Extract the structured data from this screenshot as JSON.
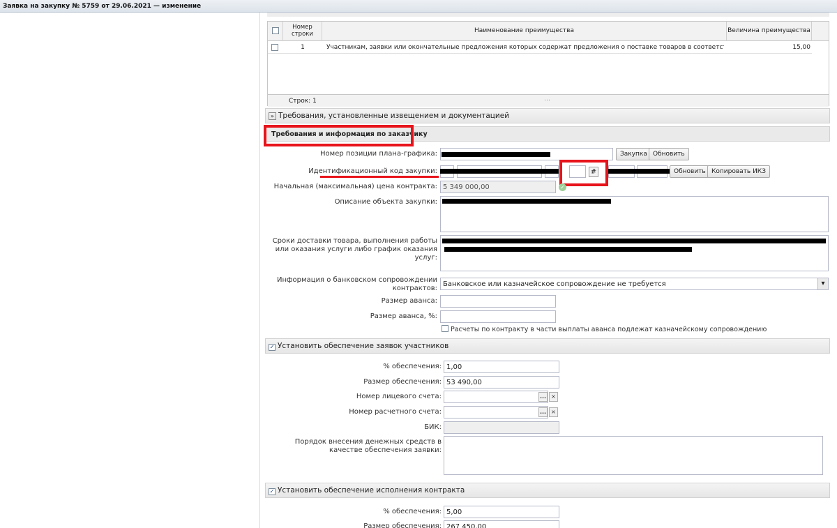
{
  "window": {
    "title": "Заявка на закупку № 5759 от 29.06.2021 — изменение"
  },
  "grid": {
    "headers": {
      "row_number": "Номер строки",
      "name": "Наименование преимущества",
      "value": "Величина преимущества"
    },
    "rows": [
      {
        "num": "1",
        "name": "Участникам, заявки или окончательные предложения которых содержат предложения о поставке товаров в соответствии с приказо…",
        "value": "15,00"
      }
    ],
    "footer": {
      "rows_count": "Строк: 1",
      "more": "…"
    }
  },
  "sections": {
    "requirements_docs": "Требования, установленные извещением и документацией",
    "customer_info": "Требования и информация по заказчику",
    "bid_security": "Установить обеспечение заявок участников",
    "contract_security": "Установить обеспечение исполнения контракта"
  },
  "customer": {
    "plan_position_label": "Номер позиции плана-графика:",
    "purchase_btn": "Закупка",
    "refresh_btn": "Обновить",
    "ikz_label": "Идентификационный код закупки:",
    "ikz_refresh_btn": "Обновить",
    "ikz_copy_btn": "Копировать ИКЗ",
    "nmck_label": "Начальная (максимальная) цена контракта:",
    "nmck_value": "5 349 000,00",
    "object_label": "Описание объекта закупки:",
    "terms_label": "Сроки доставки товара, выполнения работы или оказания услуги либо график оказания услуг:",
    "bank_label": "Информация о банковском сопровождении контрактов:",
    "bank_value": "Банковское или казначейское сопровождение не требуется",
    "advance_label": "Размер аванса:",
    "advance_pct_label": "Размер аванса, %:",
    "treasury_checkbox": "Расчеты по контракту в части выплаты аванса подлежат казначейскому сопровождению"
  },
  "bid_security": {
    "pct_label": "% обеспечения:",
    "pct_value": "1,00",
    "amount_label": "Размер обеспечения:",
    "amount_value": "53 490,00",
    "personal_account_label": "Номер лицевого счета:",
    "settlement_account_label": "Номер расчетного счета:",
    "bik_label": "БИК:",
    "procedure_label": "Порядок внесения денежных средств в качестве обеспечения заявки:"
  },
  "contract_security": {
    "pct_label": "% обеспечения:",
    "pct_value": "5,00",
    "amount_label": "Размер обеспечения:",
    "amount_value": "267 450,00"
  },
  "icons": {
    "calc": "hash-icon",
    "ellipsis": "...",
    "clear": "×",
    "dropdown": "▾",
    "check": "✓"
  }
}
